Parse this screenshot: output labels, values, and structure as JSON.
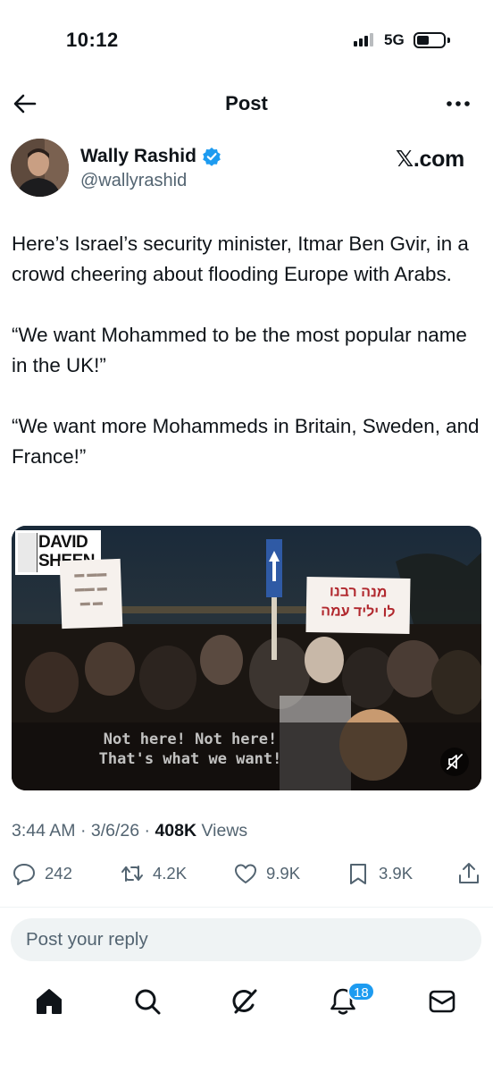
{
  "status_bar": {
    "time": "10:12",
    "network": "5G",
    "battery_level": 0.45
  },
  "nav": {
    "title": "Post",
    "back_icon": "arrow-left-icon",
    "more_icon": "more-horizontal-icon"
  },
  "author": {
    "name": "Wally Rashid",
    "handle": "@wallyrashid",
    "verified": true,
    "source": "𝕏.com"
  },
  "tweet": {
    "paragraphs": [
      "Here’s Israel’s security minister, Itmar Ben Gvir, in a crowd cheering about flooding Europe with Arabs.",
      "“We want Mohammed to be the most popular name in the UK!”",
      "“We want more Mohammeds in Britain, Sweden, and France!”"
    ]
  },
  "media": {
    "watermark_line1": "DAVID",
    "watermark_line2": "SHEEN",
    "sign_text": "מנה רבנו\nלו יליד עמה",
    "subtitle_line1": "Not here! Not here!",
    "subtitle_line2": "That's what we want!",
    "mute_icon": "volume-muted-icon"
  },
  "meta": {
    "time": "3:44 AM",
    "date": "3/6/26",
    "views_count": "408K",
    "views_label": "Views"
  },
  "actions": {
    "replies": "242",
    "reposts": "4.2K",
    "likes": "9.9K",
    "bookmarks": "3.9K"
  },
  "reply": {
    "placeholder": "Post your reply"
  },
  "bottom_nav": {
    "notifications_badge": "18",
    "tabs": [
      "home-icon",
      "search-icon",
      "grok-icon",
      "notifications-icon",
      "messages-icon"
    ]
  },
  "colors": {
    "accent": "#1d9bf0",
    "text_secondary": "#536471",
    "reply_bg": "#eff3f4"
  }
}
